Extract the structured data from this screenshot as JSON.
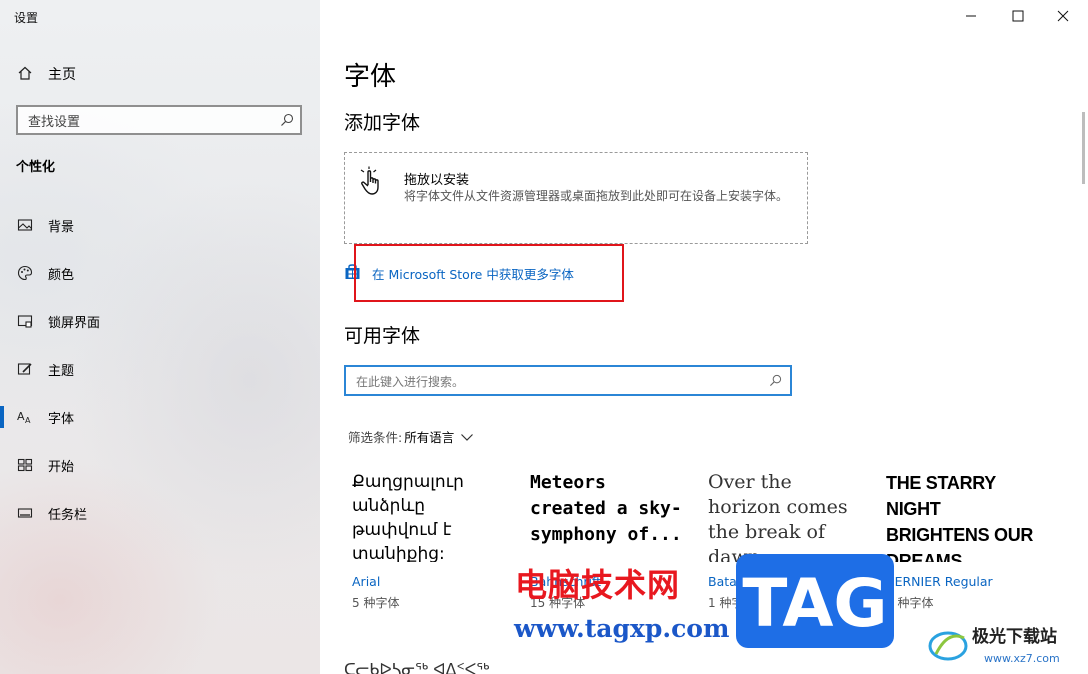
{
  "window": {
    "title": "设置"
  },
  "sidebar": {
    "home_label": "主页",
    "search_placeholder": "查找设置",
    "section_title": "个性化",
    "items": [
      {
        "label": "背景",
        "icon": "image-icon"
      },
      {
        "label": "颜色",
        "icon": "palette-icon"
      },
      {
        "label": "锁屏界面",
        "icon": "lock-screen-icon"
      },
      {
        "label": "主题",
        "icon": "theme-brush-icon"
      },
      {
        "label": "字体",
        "icon": "font-icon",
        "active": true
      },
      {
        "label": "开始",
        "icon": "start-icon"
      },
      {
        "label": "任务栏",
        "icon": "taskbar-icon"
      }
    ]
  },
  "main": {
    "title": "字体",
    "add_fonts": {
      "heading": "添加字体",
      "drop_title": "拖放以安装",
      "drop_desc": "将字体文件从文件资源管理器或桌面拖放到此处即可在设备上安装字体。",
      "store_link": "在 Microsoft Store 中获取更多字体"
    },
    "available": {
      "heading": "可用字体",
      "search_placeholder": "在此键入进行搜索。",
      "filter_label": "筛选条件:",
      "filter_value": "所有语言"
    },
    "font_cards": [
      {
        "preview": "Քաղցրալուր անձրևը թափվում է տանիքից:",
        "name": "Arial",
        "count": "5 种字体"
      },
      {
        "preview": "Meteors created a sky-symphony of...",
        "name": "Bahnschrift",
        "count": "15 种字体"
      },
      {
        "preview": "Over the horizon comes the break of dawn.",
        "name": "Batang",
        "count": "1 种字体"
      },
      {
        "preview": "THE STARRY NIGHT BRIGHTENS OUR DREAMS.",
        "name": "BERNIER Regular",
        "count": "1 种字体"
      }
    ],
    "bottom_preview": "ᑕᓕᑲᐅᓴᓂᖅ ᐊᐃᑉᐸᖅ"
  },
  "watermark": {
    "site_name": "电脑技术网",
    "site_url": "www.tagxp.com",
    "tag": "TAG",
    "logo_text": "极光下载站",
    "logo_url": "www.xz7.com"
  },
  "colors": {
    "accent": "#0a65c2",
    "highlight_box": "#e0151b",
    "search_focus": "#2b86d6"
  }
}
